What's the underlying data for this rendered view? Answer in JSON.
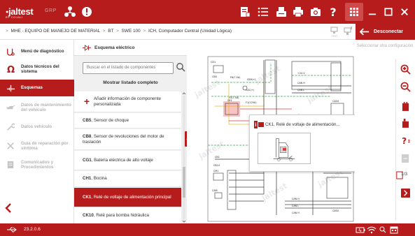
{
  "app": {
    "brand": "jaltest",
    "brand_dot": "●",
    "brand_sub": "BY COJALI",
    "group": "GRP"
  },
  "toolbar": {
    "icons": [
      "tree-icon",
      "alert-icon",
      "report-icon",
      "list-icon",
      "print-tray-icon",
      "printer-icon",
      "camera-icon",
      "help-icon",
      "apps-grid-icon"
    ],
    "window": [
      "back-arrow-icon",
      "minimize-icon",
      "maximize-icon",
      "close-icon"
    ]
  },
  "breadcrumb": {
    "items": [
      "MHE - EQUIPO DE MANEJO DE MATERIAL",
      "BT",
      "SWE 100",
      "ICH, Computador Central (Unidad Lógica)"
    ],
    "home": ">",
    "separator": ">",
    "test_label": "TEST",
    "disconnect_label": "Desconectar"
  },
  "nav": {
    "items": [
      {
        "label": "Menú de diagnóstico",
        "icon": "diagnostic-icon",
        "state": "normal"
      },
      {
        "label": "Datos técnicos del sistema",
        "icon": "ohm-icon",
        "state": "normal"
      },
      {
        "label": "Esquemas",
        "icon": "schematic-icon",
        "state": "active"
      },
      {
        "label": "Datos de mantenimiento del vehículo",
        "icon": "oil-can-icon",
        "state": "disabled"
      },
      {
        "label": "Datos vehículo",
        "icon": "wrench-icon",
        "state": "disabled"
      },
      {
        "label": "Guía de reparación por síntoma",
        "icon": "tools-icon",
        "state": "disabled"
      },
      {
        "label": "Comunicados y Procedimientos",
        "icon": "document-icon",
        "state": "disabled"
      }
    ],
    "back_icon": "chevron-left-icon"
  },
  "components": {
    "header_label": "Esquema eléctrico",
    "search_placeholder": "Buscar en el listado de componentes",
    "show_all_label": "Mostrar listado completo",
    "items": [
      {
        "code": "",
        "text": "Añadir información de componente personalizada",
        "kind": "add"
      },
      {
        "code": "CB5",
        "text": ", Sensor de choque",
        "kind": "normal"
      },
      {
        "code": "CB8",
        "text": ", Sensor de revoluciones del motor de traslación",
        "kind": "normal"
      },
      {
        "code": "CG1",
        "text": ", Batería eléctrica de alto voltaje",
        "kind": "normal"
      },
      {
        "code": "CH1",
        "text": ", Bocina",
        "kind": "normal"
      },
      {
        "code": "CK1",
        "text": ", Relé de voltaje de alimentación principal",
        "kind": "selected"
      },
      {
        "code": "CK10",
        "text": ", Relé para bomba hidráulica",
        "kind": "normal"
      }
    ]
  },
  "diagram": {
    "labels": [
      "CD1",
      "CB9(+)",
      "CB5",
      "F6(7.5A)",
      "CA1(+)",
      "F5(7.5A)",
      "CK1",
      "F1(125A)",
      "CB1",
      "CM1",
      "CB10",
      "CA04",
      "CS4",
      "CAN H",
      "CAN L",
      "+24 V",
      "CL1",
      "CAS0",
      "CAM",
      "CAN H",
      "CAN L",
      "CAN H"
    ],
    "watermark": "jaltest",
    "popup_title": "CK1, Relé de voltaje de alimentación..."
  },
  "righttools": {
    "select_config": "Seleccionar otra configuración",
    "tools": [
      "zoom-in-icon",
      "zoom-out-icon",
      "battery-icon",
      "component-info-icon",
      "conditional-help-icon",
      "toggle-layer-icon",
      "page-icon",
      "next-page-icon"
    ],
    "page_current": "1",
    "page_total": "/3"
  },
  "status": {
    "version": "23.2.0.6",
    "icons": [
      "usb-icon",
      "battery-status-icon",
      "wifi-icon",
      "percent-icon",
      "calendar-icon"
    ]
  },
  "colors": {
    "accent": "#b71c1c",
    "accent_light": "#cf4b4b",
    "wire_green": "#3aa34a",
    "wire_yellow": "#e9b824",
    "wire_red": "#d63a3a"
  }
}
